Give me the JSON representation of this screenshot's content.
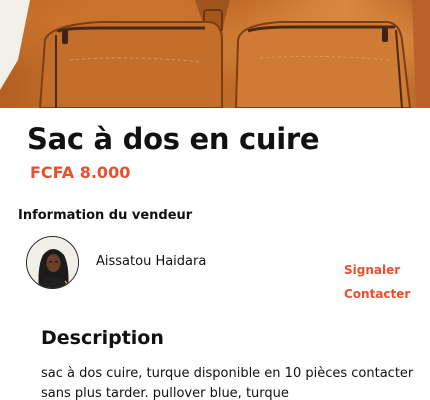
{
  "product": {
    "title": "Sac à dos en cuire",
    "price": "FCFA 8.000"
  },
  "seller": {
    "heading": "Information du vendeur",
    "name": "Aissatou Haidara",
    "report_label": "Signaler",
    "contact_label": "Contacter"
  },
  "description": {
    "heading": "Description",
    "text": "sac à dos cuire, turque  disponible en 10 pièces contacter sans plus tarder. pullover blue, turque"
  },
  "colors": {
    "accent": "#e8512e",
    "text": "#111111"
  }
}
